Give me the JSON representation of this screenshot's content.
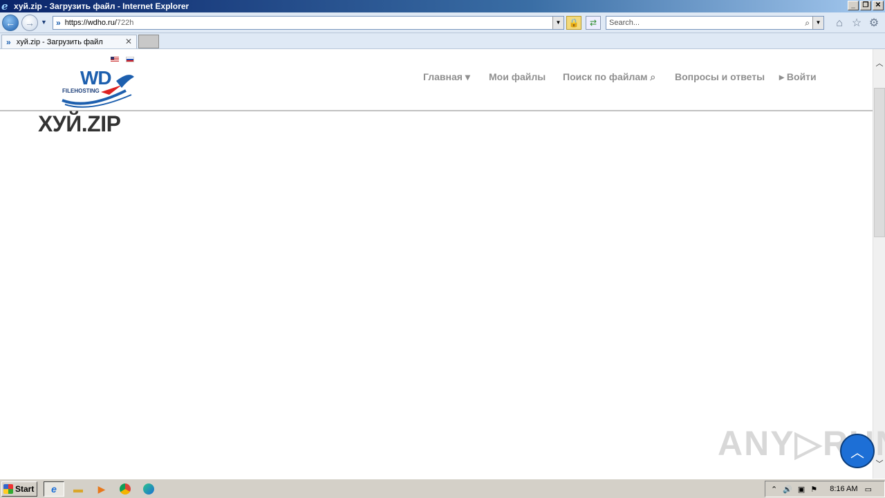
{
  "window": {
    "title": "хуй.zip - Загрузить файл - Internet Explorer"
  },
  "addressbar": {
    "url_host": "https://wdho.ru/",
    "url_path": "722h"
  },
  "search": {
    "placeholder": "Search..."
  },
  "tab": {
    "label": "хуй.zip - Загрузить файл",
    "close": "✕"
  },
  "site": {
    "logo_text": "WD",
    "logo_sub": "FILEHOSTING",
    "nav": [
      {
        "label": "Главная ▾"
      },
      {
        "label": "Мои файлы"
      },
      {
        "label": "Поиск по файлам ⌕"
      },
      {
        "label": "Вопросы и ответы"
      },
      {
        "label": "▸ Войти"
      }
    ],
    "page_title": "ХУЙ.ZIP"
  },
  "watermark": "ANY▷RUN",
  "taskbar": {
    "start_label": "Start",
    "clock": "8:16 AM"
  },
  "icons": [
    "ie-icon",
    "back-icon",
    "forward-icon",
    "lock-icon",
    "refresh-icon",
    "search-icon",
    "home-icon",
    "star-icon",
    "gear-icon",
    "close-icon",
    "scroll-up-icon",
    "scroll-down-icon",
    "chevron-up-icon"
  ],
  "colors": {
    "titlebar": "#0a246a",
    "nav_text": "#8f8f8f",
    "title_text": "#333333",
    "fab": "#1d6fd6"
  }
}
